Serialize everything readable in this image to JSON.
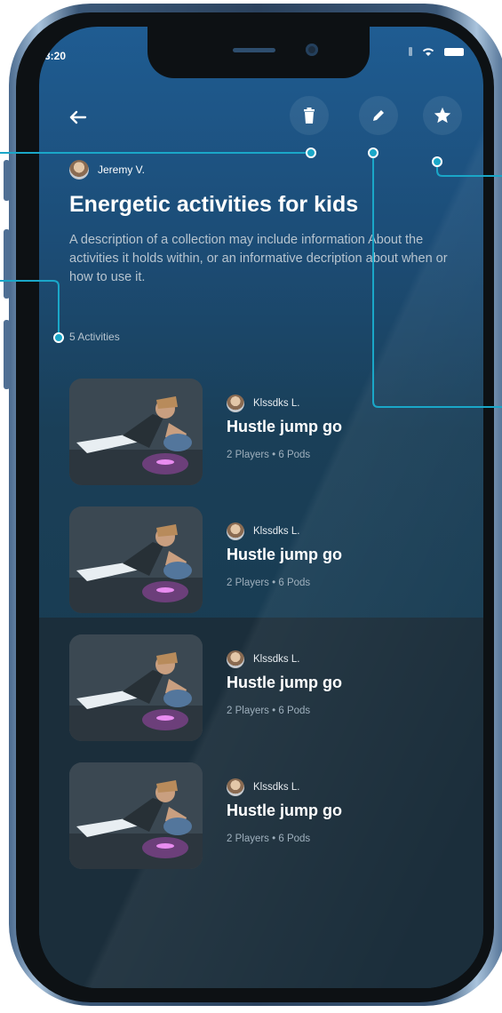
{
  "status_bar": {
    "time": "3:20"
  },
  "header": {
    "author_name": "Jeremy V.",
    "title": "Energetic activities for kids",
    "description": "A description of a collection may include information About the activities it holds within, or an informative decription about when or how to use it.",
    "activity_count": "5 Activities"
  },
  "toolbar": {
    "icons": [
      "back-arrow-icon",
      "trash-icon",
      "pencil-icon",
      "star-icon"
    ]
  },
  "activities": [
    {
      "author": "Klssdks L.",
      "title": "Hustle jump go",
      "meta": "2 Players • 6 Pods"
    },
    {
      "author": "Klssdks L.",
      "title": "Hustle jump go",
      "meta": "2 Players • 6 Pods"
    },
    {
      "author": "Klssdks L.",
      "title": "Hustle jump go",
      "meta": "2 Players • 6 Pods"
    },
    {
      "author": "Klssdks L.",
      "title": "Hustle jump go",
      "meta": "2 Players • 6 Pods"
    }
  ],
  "colors": {
    "accent": "#1aa7c8",
    "background_top": "#1f5c92",
    "background_bottom": "#17384a"
  }
}
